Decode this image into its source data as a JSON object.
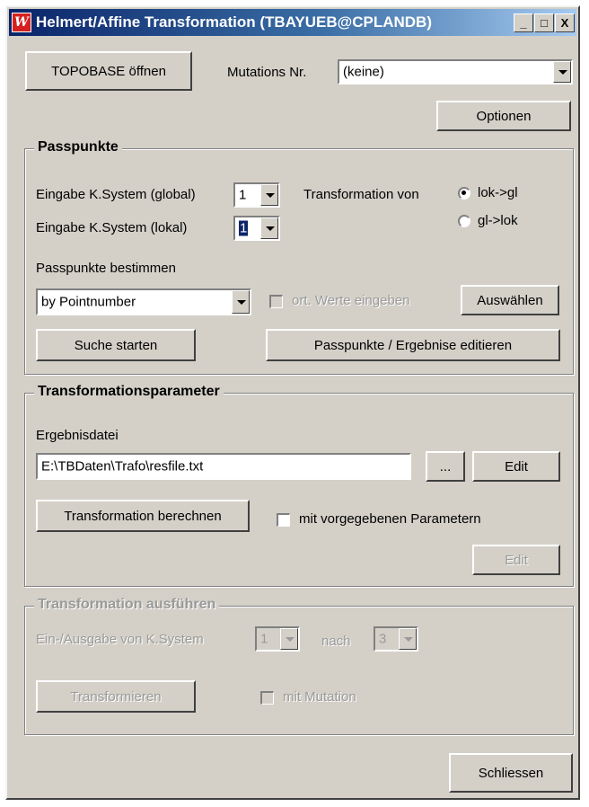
{
  "window": {
    "title": "Helmert/Affine Transformation (TBAYUEB@CPLANDB)",
    "icon_char": "W",
    "minimize_glyph": "_",
    "maximize_glyph": "□",
    "close_glyph": "X"
  },
  "top": {
    "open_button": "TOPOBASE öffnen",
    "mutation_label": "Mutations Nr.",
    "mutation_value": "(keine)",
    "options_button": "Optionen"
  },
  "passpunkte": {
    "title": "Passpunkte",
    "global_label": "Eingabe K.System (global)",
    "global_value": "1",
    "local_label": "Eingabe K.System (lokal)",
    "local_value": "1",
    "transformation_label": "Transformation von",
    "radio_options": [
      {
        "label": "lok->gl",
        "checked": true
      },
      {
        "label": "gl->lok",
        "checked": false
      }
    ],
    "determine_label": "Passpunkte bestimmen",
    "method_value": "by Pointnumber",
    "enter_local_label": "ort. Werte eingeben",
    "select_button": "Auswählen",
    "search_button": "Suche starten",
    "edit_results_button": "Passpunkte / Ergebnise editieren"
  },
  "parameter": {
    "title": "Transformationsparameter",
    "result_file_label": "Ergebnisdatei",
    "result_file_value": "E:\\TBDaten\\Trafo\\resfile.txt",
    "browse_button": "...",
    "edit_button": "Edit",
    "compute_button": "Transformation berechnen",
    "predefined_label": "mit vorgegebenen Parametern",
    "edit_disabled_button": "Edit"
  },
  "execute": {
    "title": "Transformation ausführen",
    "io_label": "Ein-/Ausgabe von K.System",
    "from_value": "1",
    "to_label": "nach",
    "to_value": "3",
    "transform_button": "Transformieren",
    "mutation_label": "mit Mutation"
  },
  "footer": {
    "close_button": "Schliessen"
  }
}
